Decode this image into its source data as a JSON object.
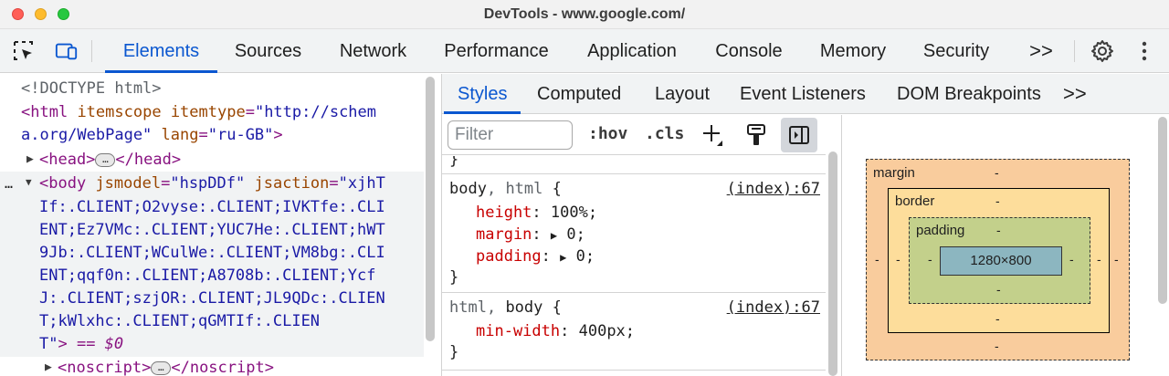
{
  "window": {
    "title": "DevTools - www.google.com/"
  },
  "toolbar": {
    "tabs": [
      "Elements",
      "Sources",
      "Network",
      "Performance",
      "Application",
      "Console",
      "Memory",
      "Security"
    ],
    "active_tab": "Elements",
    "more_label": ">>"
  },
  "elements_tree": {
    "doctype": "<!DOCTYPE html>",
    "html_open": "<html",
    "html_attr1_name": "itemscope",
    "html_attr2_name": "itemtype",
    "html_attr2_value_part1": "\"http://schem",
    "html_attr2_value_part2": "a.org/WebPage\"",
    "html_attr3_name": "lang",
    "html_attr3_value": "\"ru-GB\"",
    "head_open": "<head>",
    "head_close": "</head>",
    "body_open": "<body",
    "body_attr1_name": "jsmodel",
    "body_attr1_value": "\"hspDDf\"",
    "body_attr2_name": "jsaction",
    "body_attr2_value_lines": [
      "\"xjhT",
      "If:.CLIENT;O2vyse:.CLIENT;IVKTfe:.CLI",
      "ENT;Ez7VMc:.CLIENT;YUC7He:.CLIENT;hWT",
      "9Jb:.CLIENT;WCulWe:.CLIENT;VM8bg:.CLI",
      "ENT;qqf0n:.CLIENT;A8708b:.CLIENT;Ycf",
      "J:.CLIENT;szjOR:.CLIENT;JL9QDc:.CLIEN",
      "T;kWlxhc:.CLIENT;qGMTIf:.CLIEN",
      "T\""
    ],
    "body_selected_suffix": "> == $0",
    "noscript_open": "<noscript>",
    "noscript_close": "</noscript>",
    "ellipsis_label": "…",
    "row_dots": "…"
  },
  "styles": {
    "subtabs": [
      "Styles",
      "Computed",
      "Layout",
      "Event Listeners",
      "DOM Breakpoints"
    ],
    "active_subtab": "Styles",
    "more_label": ">>",
    "filter_placeholder": "Filter",
    "hov_label": ":hov",
    "cls_label": ".cls",
    "rules": [
      {
        "selector_dim": "body",
        "selector_sep": ", ",
        "selector_inactive": "html",
        "brace": " {",
        "source": "(index):67",
        "props": [
          {
            "name": "height",
            "value": "100%;"
          },
          {
            "name": "margin",
            "value": "0;"
          },
          {
            "name": "padding",
            "value": "0;"
          }
        ]
      },
      {
        "selector_inactive": "html",
        "selector_sep": ", ",
        "selector_dim": "body",
        "brace": " {",
        "source": "(index):67",
        "props": [
          {
            "name": "min-width",
            "value": "400px;"
          }
        ]
      }
    ],
    "closing_brace": "}"
  },
  "box_model": {
    "margin_label": "margin",
    "border_label": "border",
    "padding_label": "padding",
    "content_size": "1280×800",
    "dash": "-"
  },
  "colors": {
    "accent": "#0b57d0",
    "tag": "#881280",
    "attr_name": "#994500",
    "attr_value": "#1a1aa6",
    "css_prop": "#c80000",
    "margin_box": "#f9cc9d",
    "border_box": "#fddd9b",
    "padding_box": "#c3d08b",
    "content_box": "#8cb6c0"
  }
}
